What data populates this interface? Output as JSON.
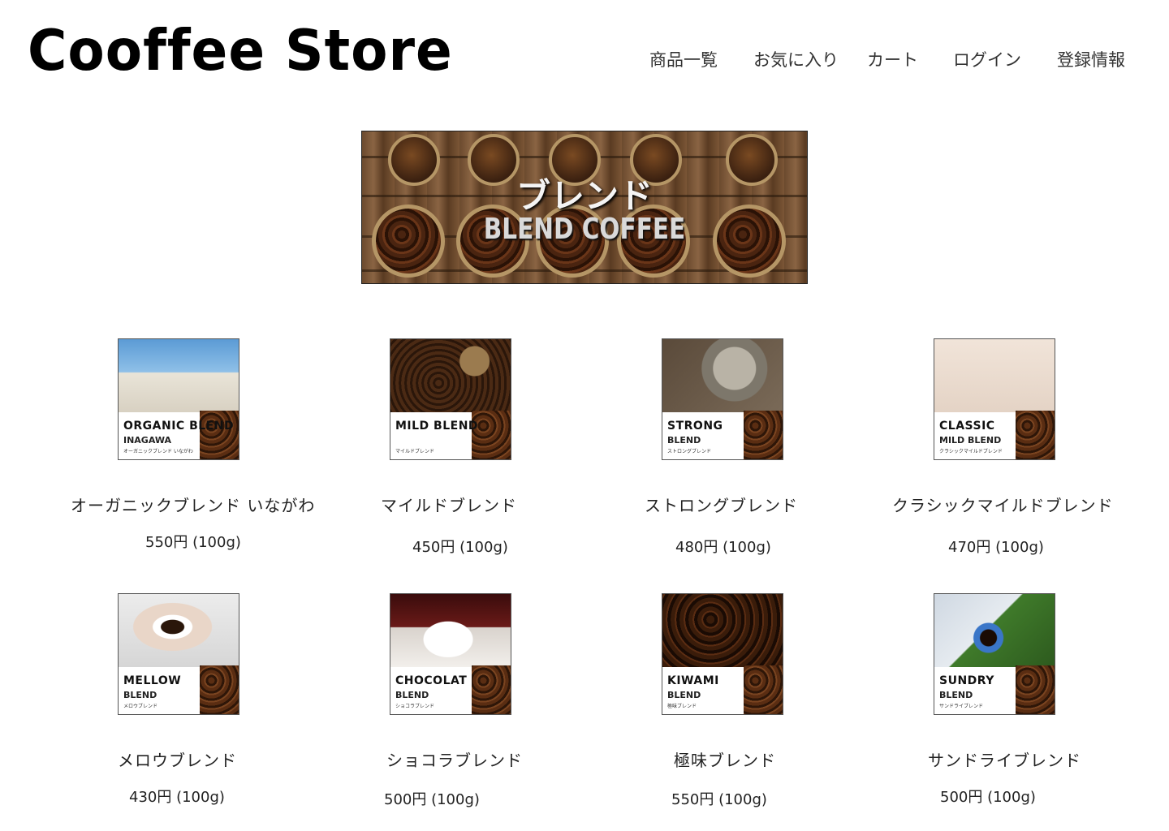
{
  "header": {
    "logo": "Cooffee Store",
    "nav": [
      "商品一覧",
      "お気に入り",
      "カート",
      "ログイン",
      "登録情報"
    ]
  },
  "banner": {
    "title_jp": "ブレンド",
    "title_en": "BLEND COFFEE"
  },
  "products": [
    {
      "name": "オーガニックブレンド いながわ",
      "price": "550円 (100g)",
      "label_line1": "ORGANIC BLEND",
      "label_line2": "INAGAWA",
      "label_small": "オーガニックブレンド いながわ",
      "photo": "building"
    },
    {
      "name": "マイルドブレンド",
      "price": "450円 (100g)",
      "label_line1": "MILD BLEND",
      "label_line2": "",
      "label_small": "マイルドブレンド",
      "photo": "scoop"
    },
    {
      "name": "ストロングブレンド",
      "price": "480円 (100g)",
      "label_line1": "STRONG",
      "label_line2": "BLEND",
      "label_small": "ストロングブレンド",
      "photo": "grinder"
    },
    {
      "name": "クラシックマイルドブレンド",
      "price": "470円 (100g)",
      "label_line1": "CLASSIC",
      "label_line2": "MILD BLEND",
      "label_small": "クラシックマイルドブレンド",
      "photo": "desk"
    },
    {
      "name": "メロウブレンド",
      "price": "430円 (100g)",
      "label_line1": "MELLOW",
      "label_line2": "BLEND",
      "label_small": "メロウブレンド",
      "photo": "cup-hands"
    },
    {
      "name": "ショコラブレンド",
      "price": "500円 (100g)",
      "label_line1": "CHOCOLAT",
      "label_line2": "BLEND",
      "label_small": "ショコラブレンド",
      "photo": "cup-saucer"
    },
    {
      "name": "極味ブレンド",
      "price": "550円 (100g)",
      "label_line1": "KIWAMI",
      "label_line2": "BLEND",
      "label_small": "極味ブレンド",
      "photo": "beans-cup"
    },
    {
      "name": "サンドライブレンド",
      "price": "500円 (100g)",
      "label_line1": "SUNDRY",
      "label_line2": "BLEND",
      "label_small": "サンドライブレンド",
      "photo": "plant"
    }
  ]
}
